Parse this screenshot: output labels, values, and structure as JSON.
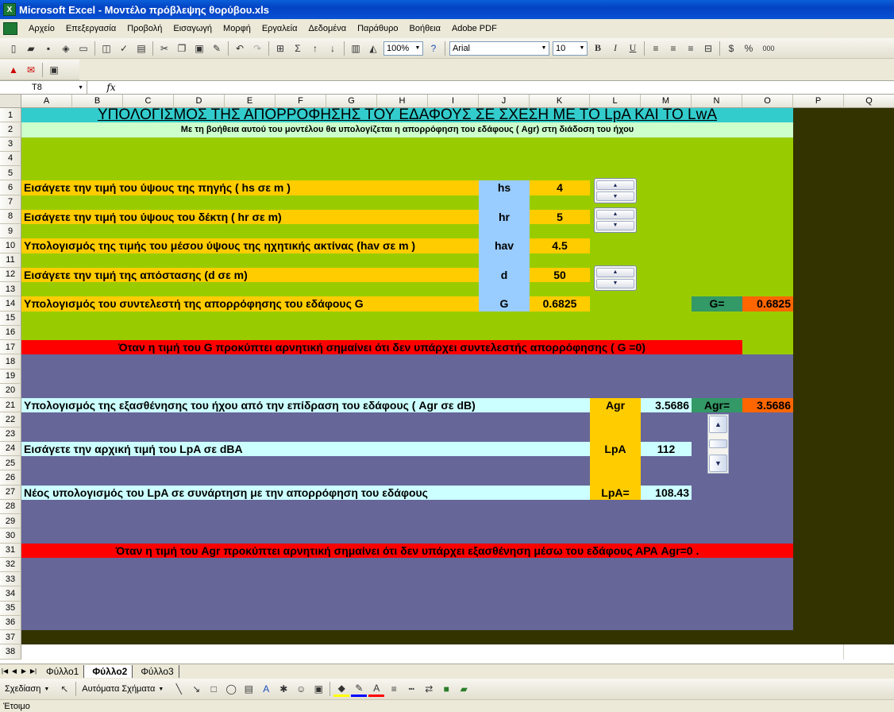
{
  "window": {
    "title": "Microsoft Excel - Μοντέλο πρόβλεψης θορύβου.xls"
  },
  "menu": [
    "Αρχείο",
    "Επεξεργασία",
    "Προβολή",
    "Εισαγωγή",
    "Μορφή",
    "Εργαλεία",
    "Δεδομένα",
    "Παράθυρο",
    "Βοήθεια",
    "Adobe PDF"
  ],
  "toolbar": {
    "zoom": "100%",
    "font": "Arial",
    "font_size": "10",
    "bold": "B",
    "italic": "I",
    "underline": "U",
    "percent": "%",
    "thousands": "000"
  },
  "formula_bar": {
    "name_box": "T8",
    "fx": "fx",
    "content": ""
  },
  "columns": [
    "A",
    "B",
    "C",
    "D",
    "E",
    "F",
    "G",
    "H",
    "I",
    "J",
    "K",
    "L",
    "M",
    "N",
    "O",
    "P",
    "Q"
  ],
  "rows": [
    "1",
    "2",
    "3",
    "4",
    "5",
    "6",
    "7",
    "8",
    "9",
    "10",
    "11",
    "12",
    "13",
    "14",
    "15",
    "16",
    "17",
    "18",
    "19",
    "20",
    "21",
    "22",
    "23",
    "24",
    "25",
    "26",
    "27",
    "28",
    "29",
    "30",
    "31",
    "32",
    "33",
    "34",
    "35",
    "36",
    "37",
    "38"
  ],
  "sheet": {
    "title": "ΥΠΟΛΟΓΙΣΜΟΣ ΤΗΣ ΑΠΟΡΡΟΦΗΣΗΣ ΤΟΥ ΕΔΑΦΟΥΣ ΣΕ ΣΧΕΣΗ ΜΕ ΤΟ LpA ΚΑΙ ΤΟ LwA",
    "subtitle": "Με τη βοήθεια αυτού του μοντέλου θα υπολογίζεται η απορρόφηση του εδάφους ( Agr)  στη διάδοση του ήχου",
    "r6_label": "Εισάγετε την τιμή του ύψους της πηγής ( hs σε m )",
    "r6_sym": "hs",
    "r6_val": "4",
    "r8_label": "Εισάγετε την τιμή του ύψους του δέκτη ( hr σε m)",
    "r8_sym": "hr",
    "r8_val": "5",
    "r10_label": "Υπολογισμός της τιμής του μέσου ύψους της ηχητικής ακτίνας (hav σε m )",
    "r10_sym": "hav",
    "r10_val": "4.5",
    "r12_label": "Εισάγετε την τιμή της απόστασης (d σε m)",
    "r12_sym": "d",
    "r12_val": "50",
    "r14_label": "Υπολογισμός του συντελεστή της απορρόφησης του εδάφους G",
    "r14_sym": "G",
    "r14_val": "0.6825",
    "g_label": "G=",
    "g_val": "0.6825",
    "r17_note": "Όταν η τιμή του G προκύπτει αρνητική σημαίνει ότι δεν υπάρχει συντελεστής απορρόφησης ( G =0)",
    "r21_label": "Υπολογισμός της εξασθένησης του ήχου από την επίδραση του εδάφους ( Agr σε dB)",
    "r21_sym": "Agr",
    "r21_val": "3.5686",
    "agr_label": "Agr=",
    "agr_val": "3.5686",
    "r24_label": "Εισάγετε την αρχική τιμή του LpA σε dBA",
    "r24_sym": "LpA",
    "r24_val": "112",
    "r27_label": "Νέος υπολογισμός του LpA σε συνάρτηση με την απορρόφηση του εδάφους",
    "r27_sym": "LpA=",
    "r27_val": "108.43",
    "r31_note": "Όταν η τιμή του Agr προκύπτει αρνητική σημαίνει ότι δεν υπάρχει εξασθένηση μέσω του εδάφους    ΑΡΑ  Agr=0 ."
  },
  "sheet_tabs": [
    "Φύλλο1",
    "Φύλλο2",
    "Φύλλο3"
  ],
  "active_tab": "Φύλλο2",
  "drawing": {
    "draw": "Σχεδίαση",
    "autoshapes": "Αυτόματα Σχήματα"
  },
  "status": "Έτοιμο",
  "colors": {
    "green": "#99cc00",
    "purple": "#666699",
    "orange": "#ffcc00",
    "teal": "#33cccc",
    "lightblue": "#99ccff",
    "red": "#ff0000",
    "darkolive": "#333300",
    "cyanpale": "#ccffff",
    "mint": "#ccffcc",
    "seagreen": "#339966",
    "orangered": "#ff6600"
  }
}
